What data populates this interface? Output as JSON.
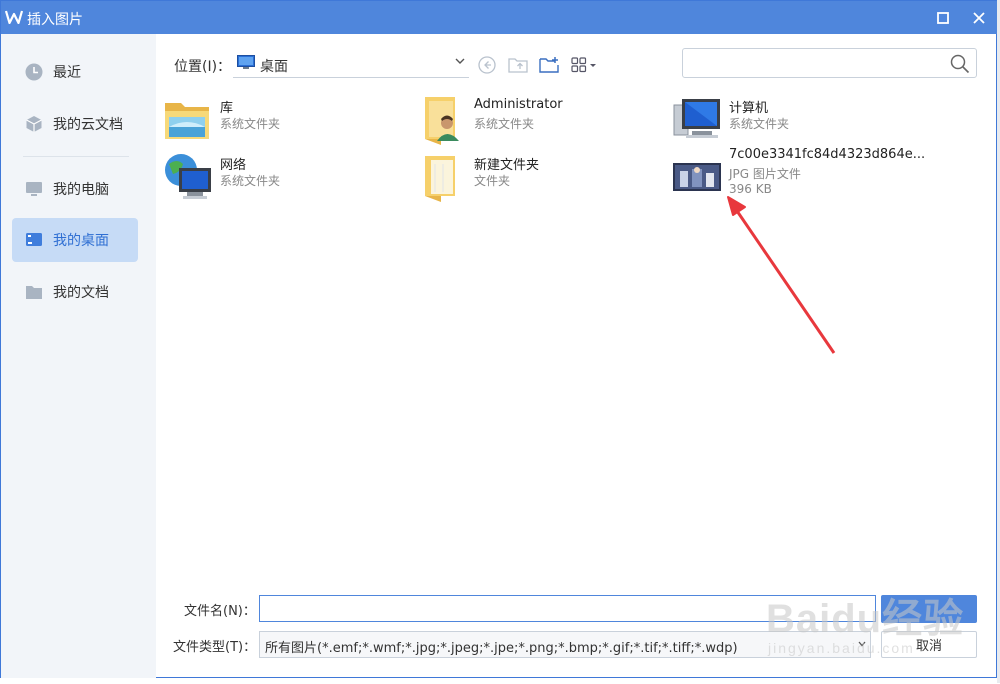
{
  "window": {
    "title": "插入图片"
  },
  "sidebar": {
    "items": [
      {
        "label": "最近",
        "icon": "clock-icon"
      },
      {
        "label": "我的云文档",
        "icon": "cloud-doc-icon"
      },
      {
        "label": "我的电脑",
        "icon": "computer-icon"
      },
      {
        "label": "我的桌面",
        "icon": "desktop-icon",
        "active": true
      },
      {
        "label": "我的文档",
        "icon": "folder-icon"
      }
    ]
  },
  "toolbar": {
    "location_label": "位置(I)：",
    "location_value": "桌面",
    "search_placeholder": ""
  },
  "files": [
    {
      "name": "库",
      "type": "系统文件夹",
      "icon": "library-folder-icon"
    },
    {
      "name": "Administrator",
      "type": "系统文件夹",
      "icon": "user-folder-icon"
    },
    {
      "name": "计算机",
      "type": "系统文件夹",
      "icon": "computer-icon"
    },
    {
      "name": "网络",
      "type": "系统文件夹",
      "icon": "network-globe-icon"
    },
    {
      "name": "新建文件夹",
      "type": "文件夹",
      "icon": "folder-icon"
    },
    {
      "name": "7c00e3341fc84d4323d864e...",
      "type": "JPG 图片文件",
      "size": "396 KB",
      "icon": "image-thumbnail-icon"
    }
  ],
  "footer": {
    "filename_label": "文件名(N)：",
    "filename_value": "",
    "filetype_label": "文件类型(T)：",
    "filetype_value": "所有图片(*.emf;*.wmf;*.jpg;*.jpeg;*.jpe;*.png;*.bmp;*.gif;*.tif;*.tiff;*.wdp)",
    "open_button": "",
    "cancel_button": "取消"
  },
  "watermark": {
    "brand": "Baidu经验",
    "url": "jingyan.baidu.com"
  },
  "colors": {
    "titlebar": "#4f86dc",
    "accent": "#2f6fd3",
    "sidebar_bg": "#f2f5f9",
    "active_item_bg": "#c6dbf6",
    "annotation_arrow": "#e8383d"
  }
}
